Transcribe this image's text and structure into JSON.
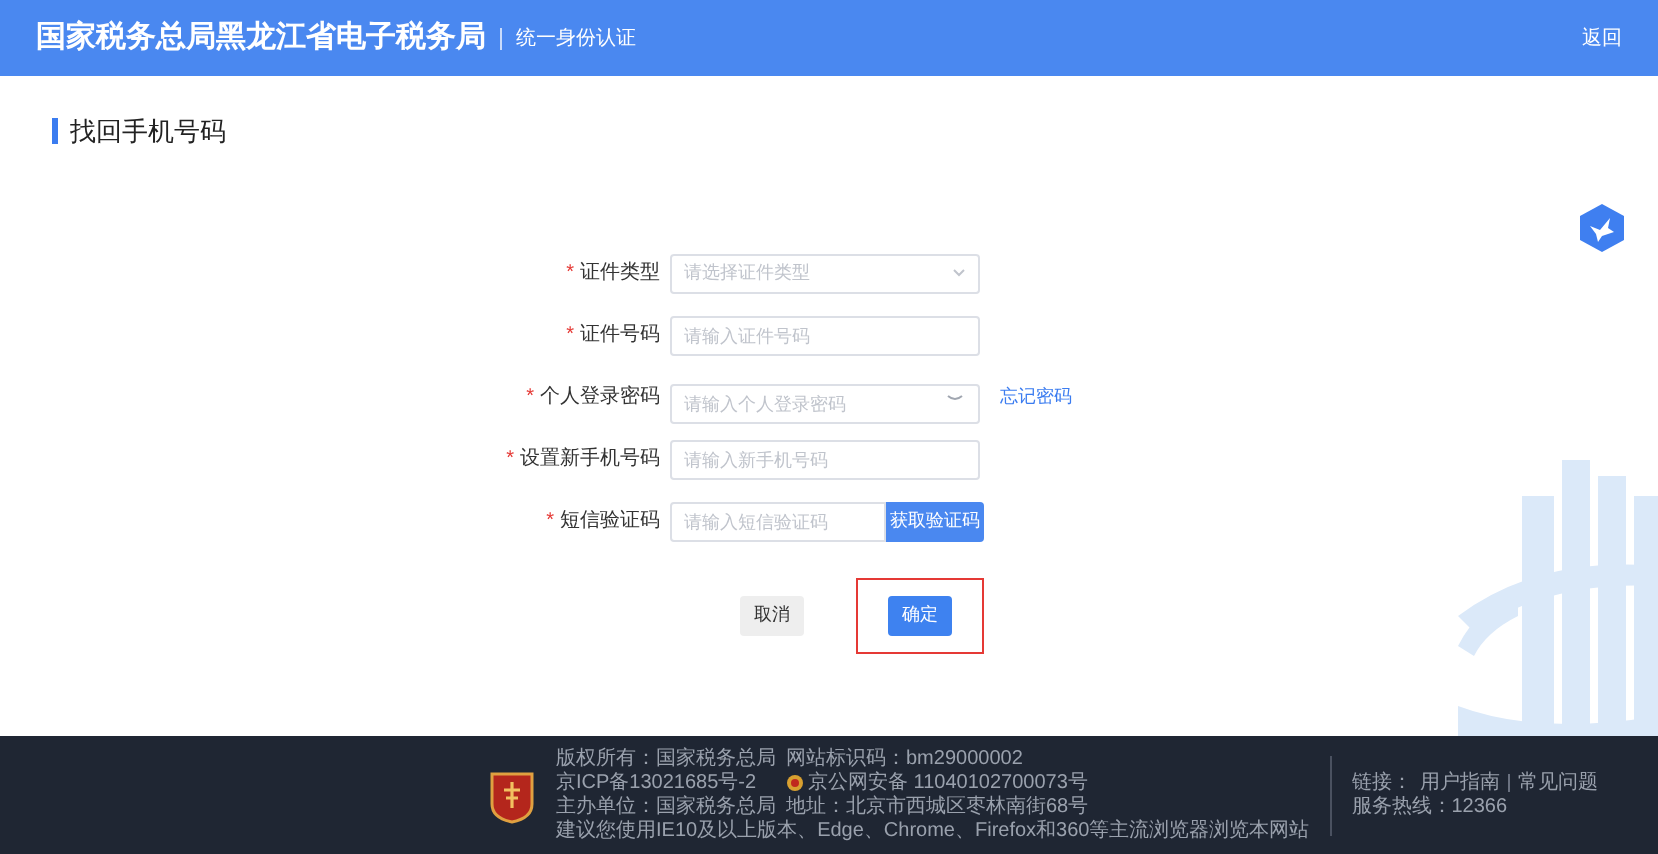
{
  "header": {
    "title": "国家税务总局黑龙江省电子税务局",
    "subtitle": "统一身份认证",
    "back_link": "返回"
  },
  "page_title": "找回手机号码",
  "form": {
    "fields": [
      {
        "kind": "select",
        "required_mark": "*",
        "label": "证件类型",
        "placeholder": "请选择证件类型"
      },
      {
        "kind": "text",
        "required_mark": "*",
        "label": "证件号码",
        "placeholder": "请输入证件号码"
      },
      {
        "kind": "password",
        "required_mark": "*",
        "label": "个人登录密码",
        "placeholder": "请输入个人登录密码",
        "link": "忘记密码"
      },
      {
        "kind": "text",
        "required_mark": "*",
        "label": "设置新手机号码",
        "placeholder": "请输入新手机号码"
      },
      {
        "kind": "code",
        "required_mark": "*",
        "label": "短信验证码",
        "placeholder": "请输入短信验证码",
        "button": "获取验证码"
      }
    ],
    "buttons": [
      {
        "label": "取消",
        "primary": false,
        "highlighted": false
      },
      {
        "label": "确定",
        "primary": true,
        "highlighted": true
      }
    ]
  },
  "footer": {
    "left": [
      [
        {
          "text": "版权所有：国家税务总局"
        },
        {
          "text": "网站标识码：bm29000002"
        }
      ],
      [
        {
          "text": "京ICP备13021685号-2"
        },
        {
          "text": "京公网安备 11040102700073号",
          "kind": "police"
        }
      ],
      [
        {
          "text": "主办单位：国家税务总局"
        },
        {
          "text": "地址：北京市西城区枣林南街68号"
        }
      ],
      [
        {
          "text": "建议您使用IE10及以上版本、Edge、Chrome、Firefox和360等主流浏览器浏览本网站"
        }
      ]
    ],
    "links_label": "链接：",
    "links": [
      "用户指南",
      "常见问题"
    ],
    "hotline": "服务热线：12366"
  }
}
